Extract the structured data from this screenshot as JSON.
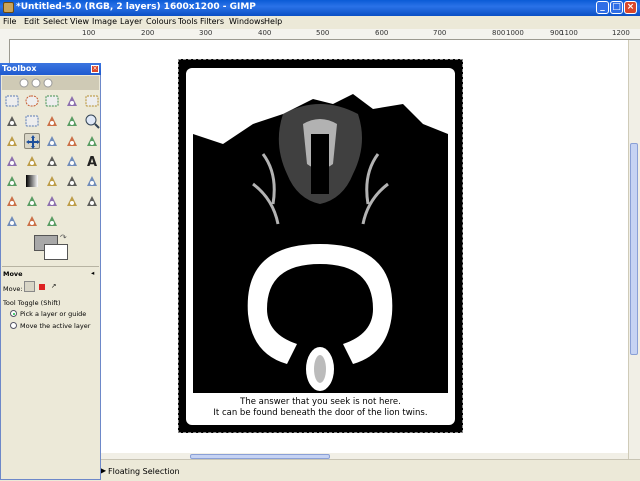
{
  "window": {
    "title": "*Untitled-5.0 (RGB, 2 layers) 1600x1200 - GIMP"
  },
  "menu": [
    "File",
    "Edit",
    "Select",
    "View",
    "Image",
    "Layer",
    "Colours",
    "Tools",
    "Filters",
    "Windows",
    "Help"
  ],
  "ruler_ticks": [
    "100",
    "200",
    "300",
    "400",
    "500",
    "600",
    "700",
    "800",
    "900",
    "1000",
    "1100",
    "1200"
  ],
  "toolbox": {
    "title": "Toolbox",
    "tools": [
      "rect-select",
      "ellipse-select",
      "free-select",
      "fuzzy-select",
      "color-select",
      "scissors",
      "foreground-select",
      "paths",
      "color-picker",
      "zoom",
      "measure",
      "move",
      "align",
      "crop",
      "rotate",
      "scale",
      "shear",
      "perspective",
      "flip",
      "text",
      "bucket-fill",
      "blend",
      "pencil",
      "paintbrush",
      "eraser",
      "airbrush",
      "ink",
      "clone",
      "heal",
      "perspective-clone",
      "blur",
      "smudge",
      "dodge-burn"
    ],
    "colors": {
      "foreground": "#a8a8a8",
      "background": "#ffffff"
    }
  },
  "tool_options": {
    "name": "Move",
    "move_label": "Move:",
    "tool_toggle": "Tool Toggle  (Shift)",
    "option1": "Pick a layer or guide",
    "option2": "Move the active layer"
  },
  "image": {
    "caption_line1": "The answer that you seek is not here.",
    "caption_line2": "It can be found beneath the door of the lion twins."
  },
  "status": {
    "text": "Floating Selection"
  },
  "colors": {
    "titlebar": "#0a5bd6",
    "chrome": "#ece9d8"
  }
}
